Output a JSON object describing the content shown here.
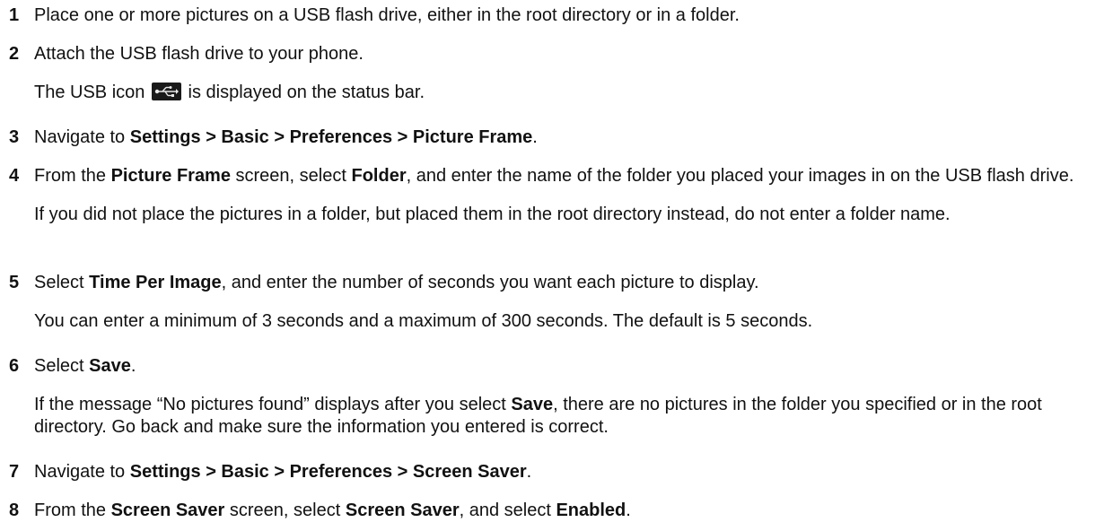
{
  "steps": [
    {
      "num": "1",
      "parts": [
        "Place one or more pictures on a USB flash drive, either in the root directory or in a folder."
      ]
    },
    {
      "num": "2",
      "parts": [
        "Attach the USB flash drive to your phone."
      ],
      "note_before_icon": "The USB icon",
      "note_after_icon": "is displayed on the status bar.",
      "icon": "usb-icon"
    },
    {
      "num": "3",
      "p1": "Navigate to ",
      "b1": "Settings > Basic > Preferences > Picture Frame",
      "p2": "."
    },
    {
      "num": "4",
      "p1": "From the ",
      "b1": "Picture Frame",
      "p2": " screen, select ",
      "b2": "Folder",
      "p3": ", and enter the name of the folder you placed your images in on the USB flash drive.",
      "note": "If you did not place the pictures in a folder, but placed them in the root directory instead, do not enter a folder name."
    },
    {
      "num": "5",
      "p1": "Select ",
      "b1": "Time Per Image",
      "p2": ", and enter the number of seconds you want each picture to display.",
      "note": "You can enter a minimum of 3 seconds and a maximum of 300 seconds. The default is 5 seconds."
    },
    {
      "num": "6",
      "p1": "Select ",
      "b1": "Save",
      "p2": ".",
      "note_p1": "If the message “No pictures found” displays after you select ",
      "note_b1": "Save",
      "note_p2": ", there are no pictures in the folder you specified or in the root directory. Go back and make sure the information you entered is correct."
    },
    {
      "num": "7",
      "p1": "Navigate to ",
      "b1": "Settings > Basic > Preferences > Screen Saver",
      "p2": "."
    },
    {
      "num": "8",
      "p1": "From the ",
      "b1": "Screen Saver",
      "p2": " screen, select ",
      "b2": "Screen Saver",
      "p3": ", and select ",
      "b3": "Enabled",
      "p4": "."
    }
  ]
}
